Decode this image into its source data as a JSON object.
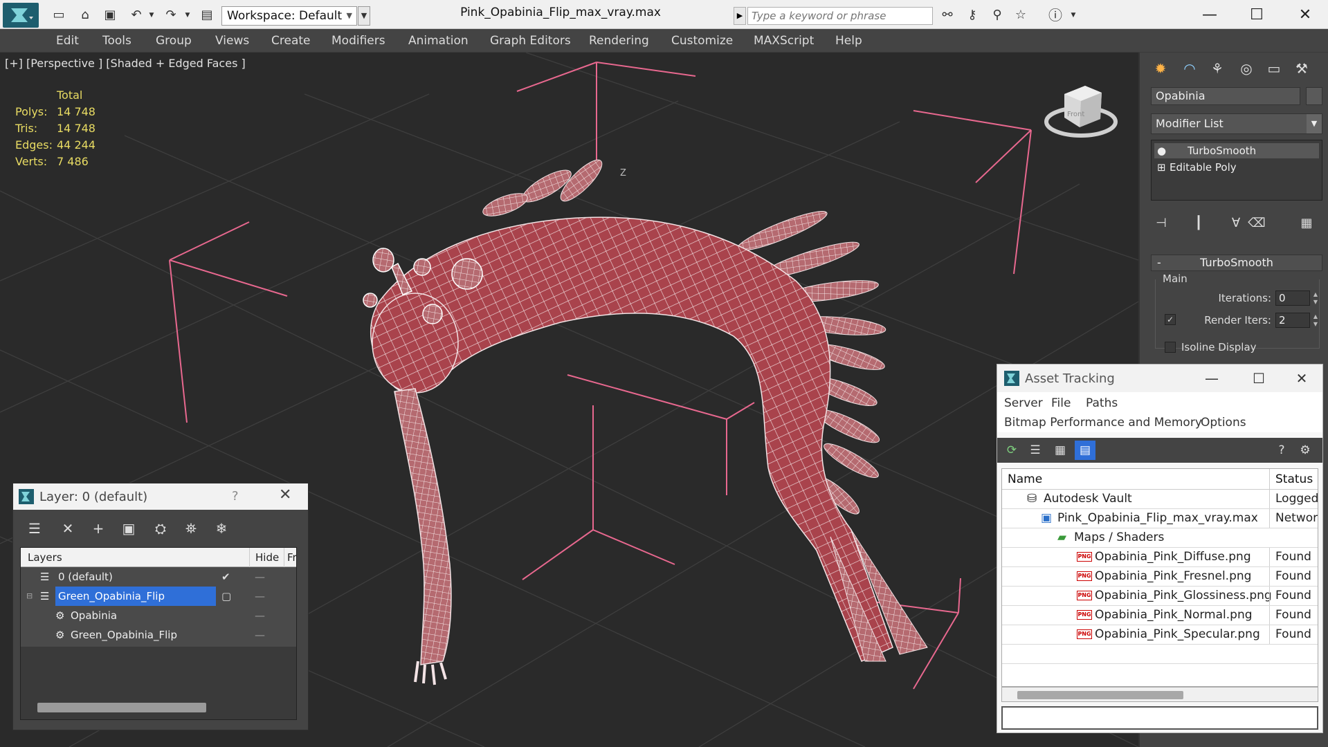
{
  "titlebar": {
    "workspace": "Workspace: Default",
    "doc_title": "Pink_Opabinia_Flip_max_vray.max",
    "search_placeholder": "Type a keyword or phrase"
  },
  "menu": [
    "Edit",
    "Tools",
    "Group",
    "Views",
    "Create",
    "Modifiers",
    "Animation",
    "Graph Editors",
    "Rendering",
    "Customize",
    "MAXScript",
    "Help"
  ],
  "viewport": {
    "label": "[+] [Perspective ] [Shaded + Edged Faces ]",
    "stats_header": "Total",
    "stats": [
      {
        "k": "Polys:",
        "v": "14 748"
      },
      {
        "k": "Tris:",
        "v": "14 748"
      },
      {
        "k": "Edges:",
        "v": "44 244"
      },
      {
        "k": "Verts:",
        "v": "7 486"
      }
    ],
    "viewcube_label": "Front",
    "axis_label": "Z"
  },
  "cmdpanel": {
    "object_name": "Opabinia",
    "modifier_list": "Modifier List",
    "stack": [
      "TurboSmooth",
      "Editable Poly"
    ],
    "rollout": "TurboSmooth",
    "group": "Main",
    "iterations_label": "Iterations:",
    "iterations": "0",
    "render_iters_label": "Render Iters:",
    "render_iters": "2",
    "isoline_label": "Isoline Display"
  },
  "layer_dialog": {
    "title": "Layer: 0 (default)",
    "help": "?",
    "col_layers": "Layers",
    "col_hide": "Hide",
    "col_freeze": "Fr",
    "rows": [
      "0 (default)",
      "Green_Opabinia_Flip",
      "Opabinia",
      "Green_Opabinia_Flip"
    ]
  },
  "asset_dialog": {
    "title": "Asset Tracking",
    "menu": [
      "Server",
      "File",
      "Paths"
    ],
    "menu2": [
      "Bitmap Performance and Memory",
      "Options"
    ],
    "col_name": "Name",
    "col_status": "Status",
    "rows": [
      {
        "name": "Autodesk Vault",
        "status": "Logged O"
      },
      {
        "name": "Pink_Opabinia_Flip_max_vray.max",
        "status": "Network"
      },
      {
        "name": "Maps / Shaders",
        "status": ""
      },
      {
        "name": "Opabinia_Pink_Diffuse.png",
        "status": "Found"
      },
      {
        "name": "Opabinia_Pink_Fresnel.png",
        "status": "Found"
      },
      {
        "name": "Opabinia_Pink_Glossiness.png",
        "status": "Found"
      },
      {
        "name": "Opabinia_Pink_Normal.png",
        "status": "Found"
      },
      {
        "name": "Opabinia_Pink_Specular.png",
        "status": "Found"
      }
    ],
    "png_badge": "PNG"
  },
  "colors": {
    "ui_dark": "#444444",
    "viewport_bg": "#2a2a2a",
    "stats_yellow": "#e9dc63",
    "bbox_pink": "#e8688f",
    "mesh_red": "#b04a52",
    "selection_blue": "#2f6fd8"
  }
}
